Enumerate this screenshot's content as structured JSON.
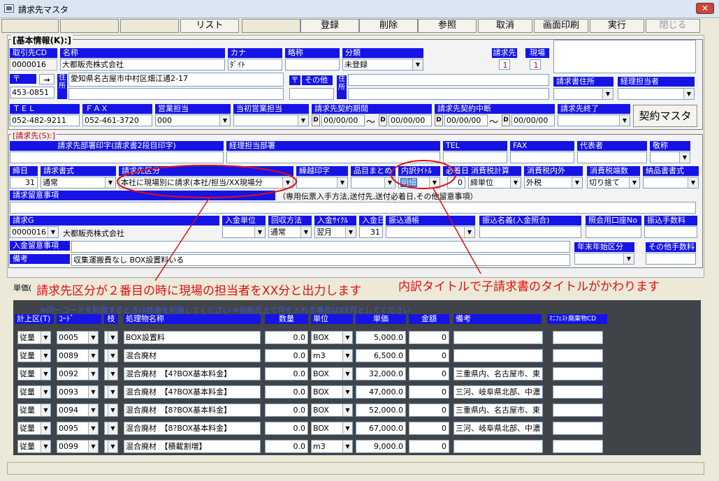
{
  "window": {
    "title": "請求先マスタ",
    "close": "✕"
  },
  "toolbar": {
    "list": "リスト",
    "register": "登録",
    "delete": "削除",
    "reference": "参照",
    "cancel": "取消",
    "print": "画面印刷",
    "execute": "実行",
    "close": "閉じる"
  },
  "basic": {
    "header": "[基本情報(K):]",
    "labels": {
      "code": "取引先CD",
      "name": "名称",
      "kana": "カナ",
      "abbr": "略称",
      "category": "分類",
      "seikyu": "請求先",
      "genba": "現場",
      "postal": "〒",
      "arrow": "→",
      "address": "住所",
      "postal2": "〒",
      "other": "その他",
      "address2": "住所",
      "invoice_addr": "請求書住所",
      "accounting": "経理担当者",
      "tel": "ＴＥＬ",
      "fax": "ＦＡＸ",
      "sales": "営業担当",
      "initial_sales": "当初営業担当",
      "contract_period": "請求先契約期間",
      "contract_suspend": "請求先契約中断",
      "end": "請求先終了"
    },
    "values": {
      "code": "0000016",
      "name": "大都販売株式会社",
      "kana": "ﾀﾞｲﾄ",
      "abbr": "",
      "category": "未登録",
      "seikyu": "1",
      "genba": "1",
      "postal": "453-0851",
      "address": "愛知県名古屋市中村区畑江通2-17",
      "tel": "052-482-9211",
      "fax": "052-461-3720",
      "sales": "000",
      "d1": "00/00/00",
      "d2": "00/00/00",
      "d3": "00/00/00",
      "d4": "00/00/00",
      "tilde": "〜",
      "dlbl": "D"
    },
    "contract_button": "契約マスタ"
  },
  "billing": {
    "header": "[請求先(S):]",
    "labels": {
      "dept_print": "請求先部署印字(請求書2段目印字)",
      "acc_dept": "経理担当部署",
      "tel": "TEL",
      "fax": "FAX",
      "rep": "代表者",
      "honorific": "敬称",
      "closing": "締日",
      "format": "請求書式",
      "division": "請求先区分",
      "carry": "繰越印字",
      "summary": "品目まとめ",
      "breakdown": "内訳ﾀｲﾄﾙ",
      "required": "必着日",
      "tax_calc": "消費税計算",
      "tax_incl": "消費税内外",
      "tax_round": "消費税端数",
      "delivery": "納品書書式",
      "notes_lbl": "請求留意事項",
      "notes_hint": "（専用伝票入手方法,送付先,送付必着日,その他留意事項）",
      "group": "請求G",
      "pay_unit": "入金単位",
      "collect": "回収方法",
      "pay_cycle": "入金ｻｲｸﾙ",
      "pay_day": "入金日",
      "transfer": "振込通帳",
      "transfer_name": "振込名義(入金照合)",
      "ref_account": "照会用口座No",
      "fee": "振込手数料",
      "pay_notes": "入金留意事項",
      "year_end": "年末年始区分",
      "other_fee": "その他手数料",
      "remarks": "備考"
    },
    "values": {
      "closing": "31",
      "format": "通常",
      "division": "本社に現場別に請求(本社/担当/XX現場分",
      "required": "0",
      "breakdown": "明細",
      "tax_calc": "締単位",
      "tax_incl": "外税",
      "tax_round": "切り捨て",
      "group": "0000016",
      "group_name": "大都販売株式会社",
      "collect": "通常",
      "pay_cycle": "翌月",
      "pay_day": "31",
      "remarks": "収集運搬費なし BOX設置料いる"
    }
  },
  "annotations": {
    "left": "請求先区分が２番目の時に現場の担当者をXX分と出力します",
    "right": "内訳タイトルで子請求書のタイトルがかわります"
  },
  "unit_label": "単価(",
  "grid": {
    "note": "※同一コードを利用するときは枝番を利用してください ※自動売上で月を入れる場合はXX月としてください",
    "headers": {
      "tally": "計上区(T)",
      "code": "ｺｰﾄﾞ",
      "branch": "枝",
      "item": "処理物名称",
      "qty": "数量",
      "unit": "単位",
      "price": "単価",
      "amount": "金額",
      "memo": "備考",
      "manifest": "ﾏﾆﾌｪｽﾄ廃棄物CD"
    },
    "rows": [
      {
        "kind": "従量",
        "code": "0005",
        "name": "BOX設置料",
        "qty": "0.0",
        "unit": "BOX",
        "price": "5,000.0",
        "amount": "0",
        "memo": ""
      },
      {
        "kind": "従量",
        "code": "0089",
        "name": "混合廃材",
        "qty": "0.0",
        "unit": "m3",
        "price": "6,500.0",
        "amount": "0",
        "memo": ""
      },
      {
        "kind": "従量",
        "code": "0092",
        "name": "混合廃材　【4?BOX基本料金】",
        "qty": "0.0",
        "unit": "BOX",
        "price": "32,000.0",
        "amount": "0",
        "memo": "三重県内、名古屋市、東"
      },
      {
        "kind": "従量",
        "code": "0093",
        "name": "混合廃材　【4?BOX基本料金】",
        "qty": "0.0",
        "unit": "BOX",
        "price": "47,000.0",
        "amount": "0",
        "memo": "三河、岐阜県北部、中濃"
      },
      {
        "kind": "従量",
        "code": "0094",
        "name": "混合廃材　【8?BOX基本料金】",
        "qty": "0.0",
        "unit": "BOX",
        "price": "52,000.0",
        "amount": "0",
        "memo": "三重県内、名古屋市、東"
      },
      {
        "kind": "従量",
        "code": "0095",
        "name": "混合廃材　【8?BOX基本料金】",
        "qty": "0.0",
        "unit": "BOX",
        "price": "67,000.0",
        "amount": "0",
        "memo": "三河、岐阜県北部、中濃"
      },
      {
        "kind": "従量",
        "code": "0099",
        "name": "混合廃材　【積載割増】",
        "qty": "0.0",
        "unit": "m3",
        "price": "9,000.0",
        "amount": "0",
        "memo": ""
      }
    ]
  }
}
